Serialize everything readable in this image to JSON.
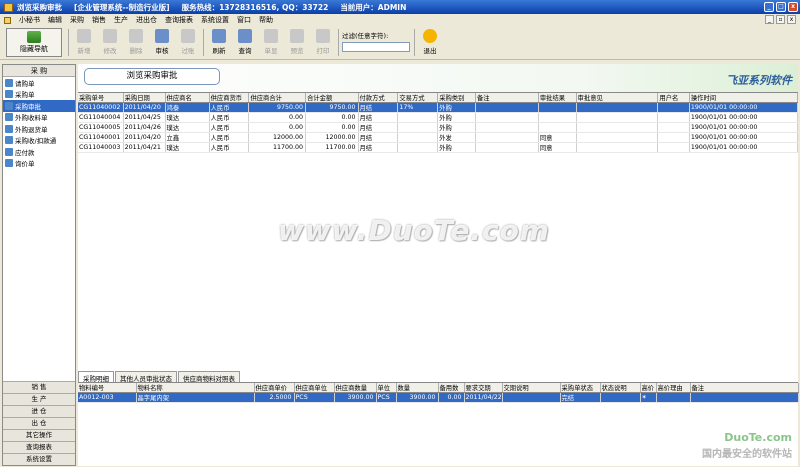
{
  "window": {
    "title": "浏览采购审批",
    "subtitle": "[企业管理系统--制造行业版]",
    "hotline": "服务热线：13728316516, QQ：33722",
    "user": "当前用户：ADMIN"
  },
  "menu": [
    "小秘书",
    "编辑",
    "采购",
    "销售",
    "生产",
    "进出仓",
    "查询报表",
    "系统设置",
    "窗口",
    "帮助"
  ],
  "toolbar": {
    "nav_hide": "隐藏导航",
    "buttons": [
      {
        "label": "新增",
        "enabled": false
      },
      {
        "label": "修改",
        "enabled": false
      },
      {
        "label": "删除",
        "enabled": false
      },
      {
        "label": "审核",
        "enabled": true
      },
      {
        "label": "过账",
        "enabled": false
      },
      {
        "label": "刷新",
        "enabled": true
      },
      {
        "label": "查询",
        "enabled": true
      },
      {
        "label": "单显",
        "enabled": false
      },
      {
        "label": "预览",
        "enabled": false
      },
      {
        "label": "打印",
        "enabled": false
      }
    ],
    "filter_label": "过滤(任意字符):",
    "filter_value": "",
    "exit": "退出"
  },
  "left_panel": {
    "header": "采  购",
    "items": [
      "请购单",
      "采购单",
      "采购审批",
      "外购收料单",
      "外购退货单",
      "采购收/扣款通",
      "应付款",
      "询价单"
    ],
    "selected_index": 2,
    "bottom_tabs": [
      "销  售",
      "生  产",
      "进  仓",
      "出  仓",
      "其它操作",
      "查询报表",
      "系统设置"
    ]
  },
  "page_title": "浏览采购审批",
  "brand": "飞亚系列软件",
  "grid1": {
    "columns": [
      "采购单号",
      "采购日期",
      "供应商名",
      "供应商货币",
      "供应商合计",
      "合计金额",
      "付款方式",
      "交易方式",
      "采购类别",
      "备注",
      "审批结果",
      "审批意见",
      "用户名",
      "操作时间"
    ],
    "rows": [
      [
        "CG11040002",
        "2011/04/20",
        "鸿泰",
        "人民币",
        "9750.00",
        "9750.00",
        "月结",
        "17%",
        "外购",
        "",
        "",
        "",
        "",
        "1900/01/01 00:00:00"
      ],
      [
        "CG11040004",
        "2011/04/25",
        "璞达",
        "人民币",
        "0.00",
        "0.00",
        "月结",
        "",
        "外购",
        "",
        "",
        "",
        "",
        "1900/01/01 00:00:00"
      ],
      [
        "CG11040005",
        "2011/04/26",
        "璞达",
        "人民币",
        "0.00",
        "0.00",
        "月结",
        "",
        "外购",
        "",
        "",
        "",
        "",
        "1900/01/01 00:00:00"
      ],
      [
        "CG11040001",
        "2011/04/20",
        "立鑫",
        "人民币",
        "12000.00",
        "12000.00",
        "月结",
        "",
        "外发",
        "",
        "同意",
        "",
        "",
        "1900/01/01 00:00:00"
      ],
      [
        "CG11040003",
        "2011/04/21",
        "璞达",
        "人民币",
        "11700.00",
        "11700.00",
        "月结",
        "",
        "外购",
        "",
        "同意",
        "",
        "",
        "1900/01/01 00:00:00"
      ]
    ],
    "selected_row": 0
  },
  "tabs": [
    "采购明细",
    "其他人员审批状态",
    "供应商物料对照表"
  ],
  "grid2": {
    "columns": [
      "物料编号",
      "物料名称",
      "供应商单价",
      "供应商单位",
      "供应商数量",
      "单位",
      "数量",
      "备用数",
      "要求交期",
      "交期说明",
      "采购单状态",
      "状态说明",
      "高价",
      "高价理由",
      "备注"
    ],
    "rows": [
      [
        "A0012-003",
        "晶字尾内架",
        "2.5000",
        "PCS",
        "3900.00",
        "PCS",
        "3900.00",
        "0.00",
        "2011/04/22",
        "",
        "完结",
        "",
        "✶",
        "",
        ""
      ]
    ]
  },
  "watermarks": {
    "main": "www.DuoTe.com",
    "site": "DuoTe.com",
    "slogan": "国内最安全的软件站"
  }
}
